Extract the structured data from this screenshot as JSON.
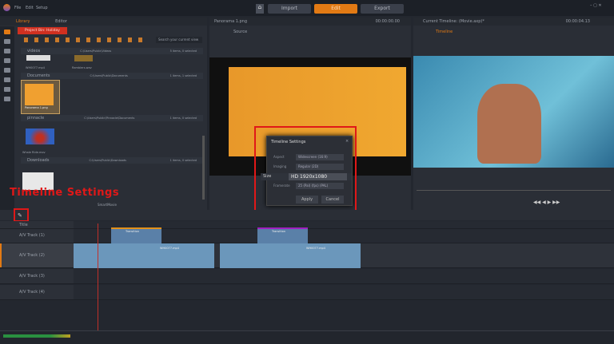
{
  "menu": {
    "items": [
      "File",
      "Edit",
      "Setup"
    ]
  },
  "nav": {
    "import": "Import",
    "edit": "Edit",
    "export": "Export"
  },
  "library": {
    "tab_library": "Library",
    "tab_editor": "Editor",
    "project_bin": "Project Bin: Holiday",
    "search_placeholder": "Search your current view",
    "folders": [
      {
        "name": "videos",
        "path": "C:\\Users\\Public\\Videos",
        "count": "5 items, 0 selected",
        "items": [
          "WH0077.mp4",
          "Ramblers.wav"
        ]
      },
      {
        "name": "Documents",
        "path": "C:\\Users\\Public\\Documents",
        "count": "1 items, 1 selected",
        "items": [
          "Panorama 1.png"
        ]
      },
      {
        "name": "pinnacle",
        "path": "C:\\Users\\Public\\Pinnacle\\Documents",
        "count": "1 items, 0 selected",
        "items": [
          "Whale Ride.mov"
        ]
      },
      {
        "name": "Downloads",
        "path": "C:\\Users\\Public\\Downloads",
        "count": "1 items, 0 selected",
        "items": [
          ""
        ]
      }
    ],
    "smartmovie": "SmartMovie"
  },
  "source_player": {
    "title": "Panorama 1.png",
    "timecode": "00:00:00.00",
    "tab": "Source"
  },
  "timeline_player": {
    "title": "Current Timeline: (Movie.axp)*",
    "timecode": "00:00:04.13",
    "tab": "Timeline"
  },
  "dialog": {
    "title": "Timeline Settings",
    "aspect_label": "Aspect",
    "aspect": "Widescreen (16:9)",
    "imaging_label": "Imaging",
    "imaging": "Regular (2D)",
    "size_label": "Size",
    "size": "HD 1920x1080",
    "framerate_label": "Framerate",
    "framerate": "25 (Pal) (fps) (PAL)",
    "apply": "Apply",
    "cancel": "Cancel"
  },
  "annotation": {
    "label": "Timeline Settings",
    "color": "#e01818"
  },
  "timeline": {
    "tracks": [
      "Title",
      "A/V Track (1)",
      "A/V Track (2)",
      "A/V Track (3)",
      "A/V Track (4)"
    ],
    "title_clip": "Transition",
    "clip_label": "WH0077.mp4"
  },
  "colors": {
    "accent": "#e27a14",
    "clip": "#6b97bb",
    "playhead": "#c0302a"
  }
}
